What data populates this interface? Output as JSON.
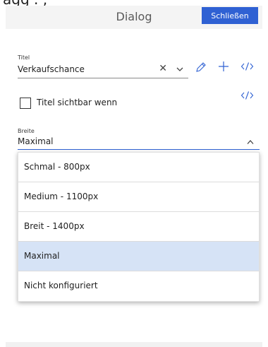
{
  "header": {
    "title": "Dialog",
    "close_label": "Schließen"
  },
  "title_field": {
    "label": "Titel",
    "value": "Verkaufschance"
  },
  "title_visible": {
    "label": "Titel sichtbar wenn",
    "checked": false
  },
  "width_field": {
    "label": "Breite",
    "value": "Maximal"
  },
  "dropdown": {
    "options": [
      {
        "label": "Schmal - 800px"
      },
      {
        "label": "Medium - 1100px"
      },
      {
        "label": "Breit - 1400px"
      },
      {
        "label": "Maximal",
        "selected": true
      },
      {
        "label": "Nicht konfiguriert"
      }
    ]
  },
  "colors": {
    "accent": "#2f61d3",
    "selected_bg": "#d6e3f6",
    "header_bg": "#f4f4f4",
    "icon_color": "#2f61d3"
  },
  "icons": {
    "clear": "close-icon",
    "expand": "chevron-down-icon",
    "edit": "pencil-icon",
    "add": "plus-icon",
    "code": "code-icon",
    "collapse": "chevron-up-icon"
  }
}
